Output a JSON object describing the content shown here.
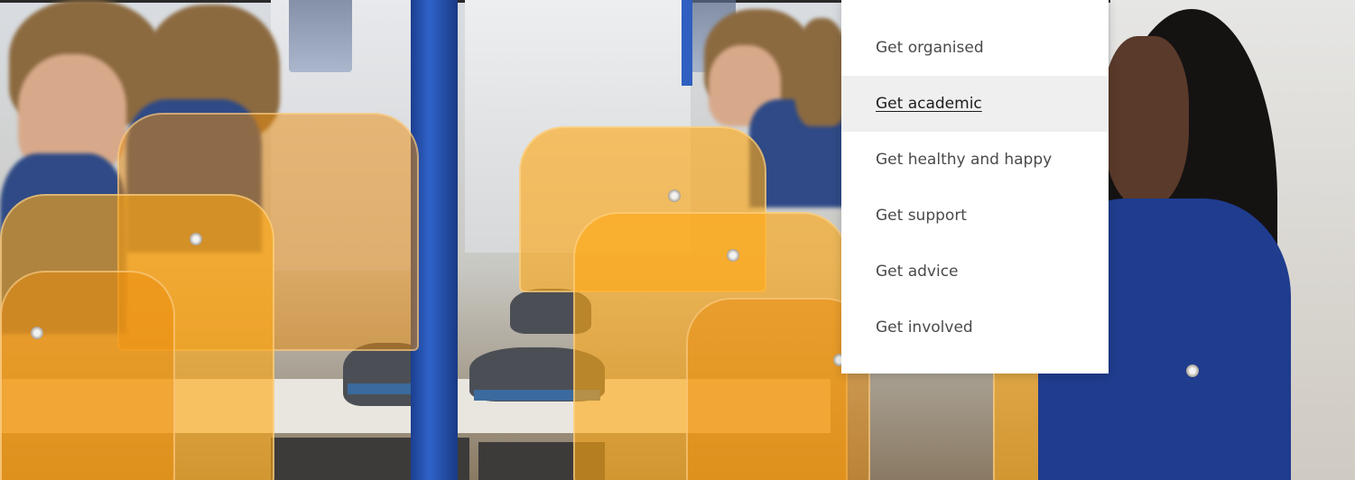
{
  "menu": {
    "items": [
      {
        "label": "Get organised"
      },
      {
        "label": "Get academic"
      },
      {
        "label": "Get healthy and happy"
      },
      {
        "label": "Get support"
      },
      {
        "label": "Get advice"
      },
      {
        "label": "Get involved"
      }
    ],
    "active_index": 1
  },
  "colors": {
    "menu_background": "#ffffff",
    "menu_active_background": "#efefef",
    "menu_text": "#4a4a4a",
    "menu_active_text": "#1d1d1d",
    "uniform_blue": "#1f3c8e",
    "acrylic_orange": "#ffa814"
  }
}
